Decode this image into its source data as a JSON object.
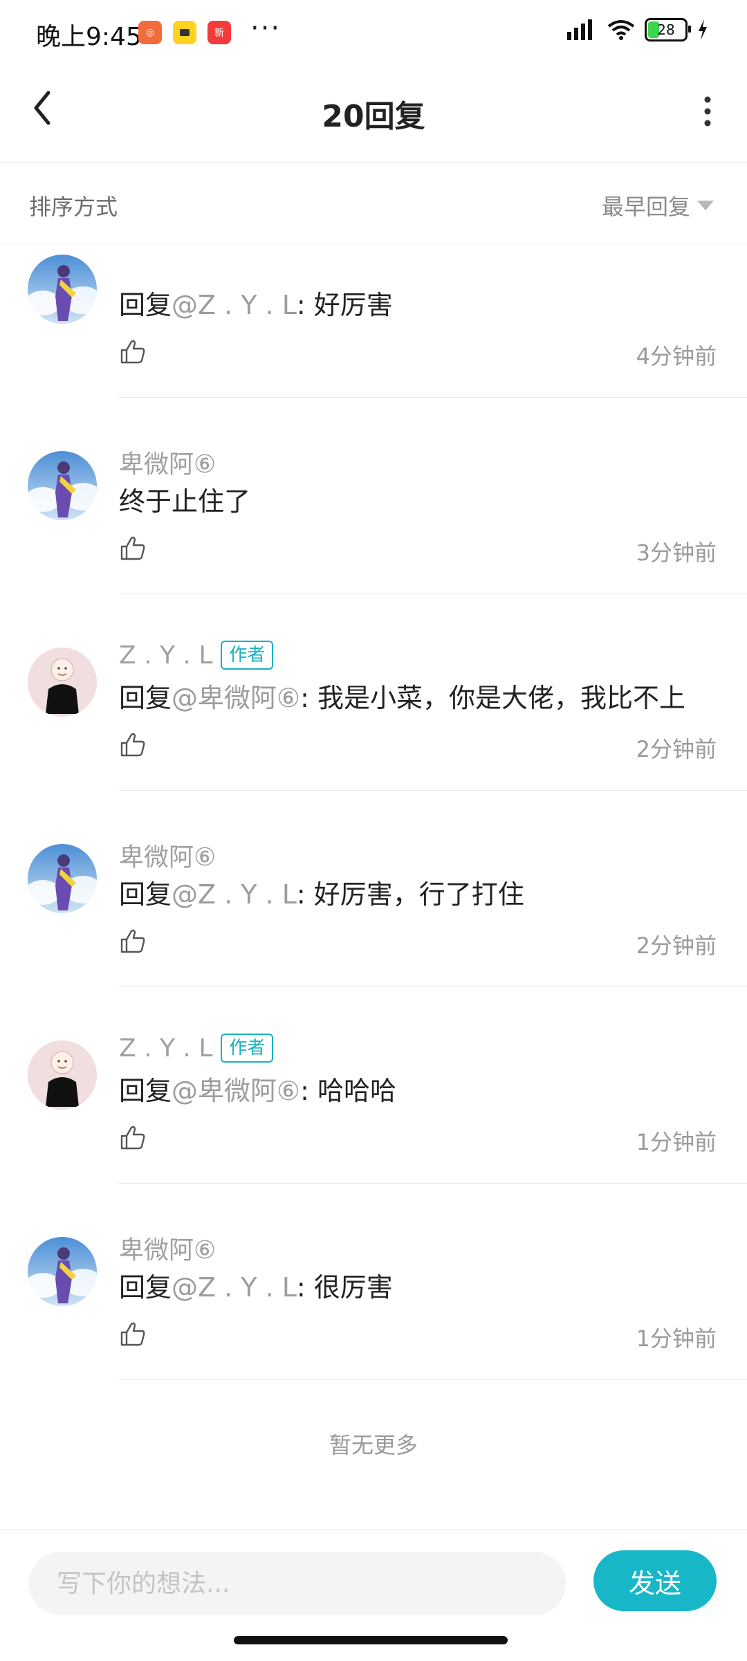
{
  "status_bar": {
    "time": "晚上9:45",
    "more": "···",
    "battery": "28",
    "battery_color": "#3cd54e"
  },
  "header": {
    "title": "20回复"
  },
  "sort_bar": {
    "label": "排序方式",
    "selected": "最早回复"
  },
  "comments": [
    {
      "name": "",
      "badge": "",
      "prefix": "回复",
      "mention": "@Z . Y . L",
      "text": ": 好厉害",
      "time": "4分钟前",
      "avatar": "avatar-purple"
    },
    {
      "name": "卑微阿⑥",
      "badge": "",
      "prefix": "",
      "mention": "",
      "text": "终于止住了",
      "time": "3分钟前",
      "avatar": "avatar-purple"
    },
    {
      "name": "Z . Y . L",
      "badge": "作者",
      "prefix": "回复",
      "mention": "@卑微阿⑥",
      "text": ": 我是小菜，你是大佬，我比不上",
      "time": "2分钟前",
      "avatar": "avatar-girl"
    },
    {
      "name": "卑微阿⑥",
      "badge": "",
      "prefix": "回复",
      "mention": "@Z . Y . L",
      "text": ": 好厉害，行了打住",
      "time": "2分钟前",
      "avatar": "avatar-purple"
    },
    {
      "name": "Z . Y . L",
      "badge": "作者",
      "prefix": "回复",
      "mention": "@卑微阿⑥",
      "text": ": 哈哈哈",
      "time": "1分钟前",
      "avatar": "avatar-girl"
    },
    {
      "name": "卑微阿⑥",
      "badge": "",
      "prefix": "回复",
      "mention": "@Z . Y . L",
      "text": ": 很厉害",
      "time": "1分钟前",
      "avatar": "avatar-purple"
    }
  ],
  "no_more": "暂无更多",
  "composer": {
    "placeholder": "写下你的想法...",
    "send_label": "发送"
  },
  "colors": {
    "accent": "#18b7c8",
    "badge": "#19b1c1"
  }
}
